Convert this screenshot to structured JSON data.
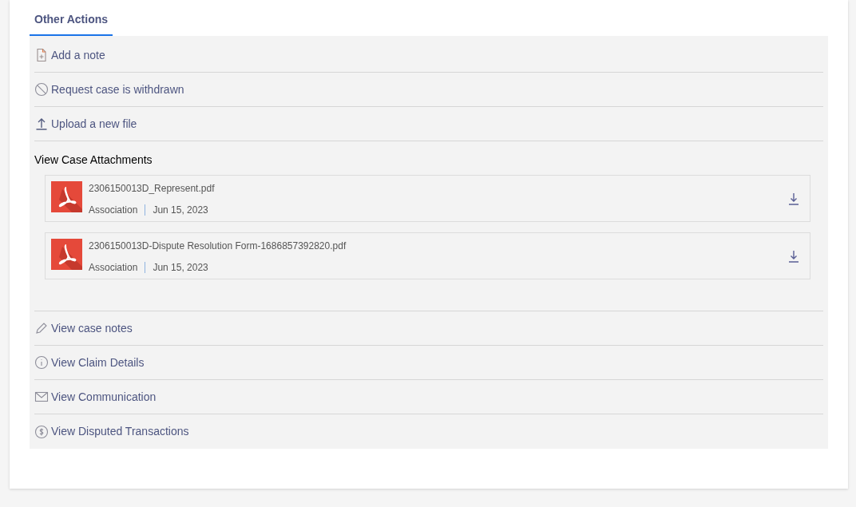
{
  "tabs": [
    {
      "label": "Other Actions",
      "selected": true
    }
  ],
  "actions_top": [
    {
      "label": "Add a note"
    },
    {
      "label": "Request case is withdrawn"
    },
    {
      "label": "Upload a new file"
    }
  ],
  "attachments": {
    "title": "View Case Attachments",
    "files": [
      {
        "name": "2306150013D_Represent.pdf",
        "source": "Association",
        "date": "Jun 15, 2023"
      },
      {
        "name": "2306150013D-Dispute Resolution Form-1686857392820.pdf",
        "source": "Association",
        "date": "Jun 15, 2023"
      }
    ]
  },
  "actions_bottom": [
    {
      "label": "View case notes"
    },
    {
      "label": "View Claim Details"
    },
    {
      "label": "View Communication"
    },
    {
      "label": "View Disputed Transactions"
    }
  ]
}
